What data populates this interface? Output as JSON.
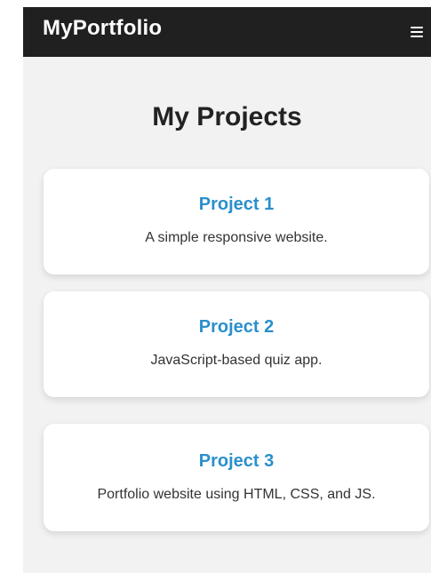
{
  "navbar": {
    "brand": "MyPortfolio",
    "menu_icon": "hamburger-menu-icon"
  },
  "main": {
    "title": "My Projects",
    "projects": [
      {
        "title": "Project 1",
        "description": "A simple responsive website."
      },
      {
        "title": "Project 2",
        "description": "JavaScript-based quiz app."
      },
      {
        "title": "Project 3",
        "description": "Portfolio website using HTML, CSS, and JS."
      }
    ]
  },
  "colors": {
    "navbar_background": "#202020",
    "page_background": "#f2f2f2",
    "card_background": "#ffffff",
    "project_title": "#2a8fcc",
    "text": "#333333"
  }
}
